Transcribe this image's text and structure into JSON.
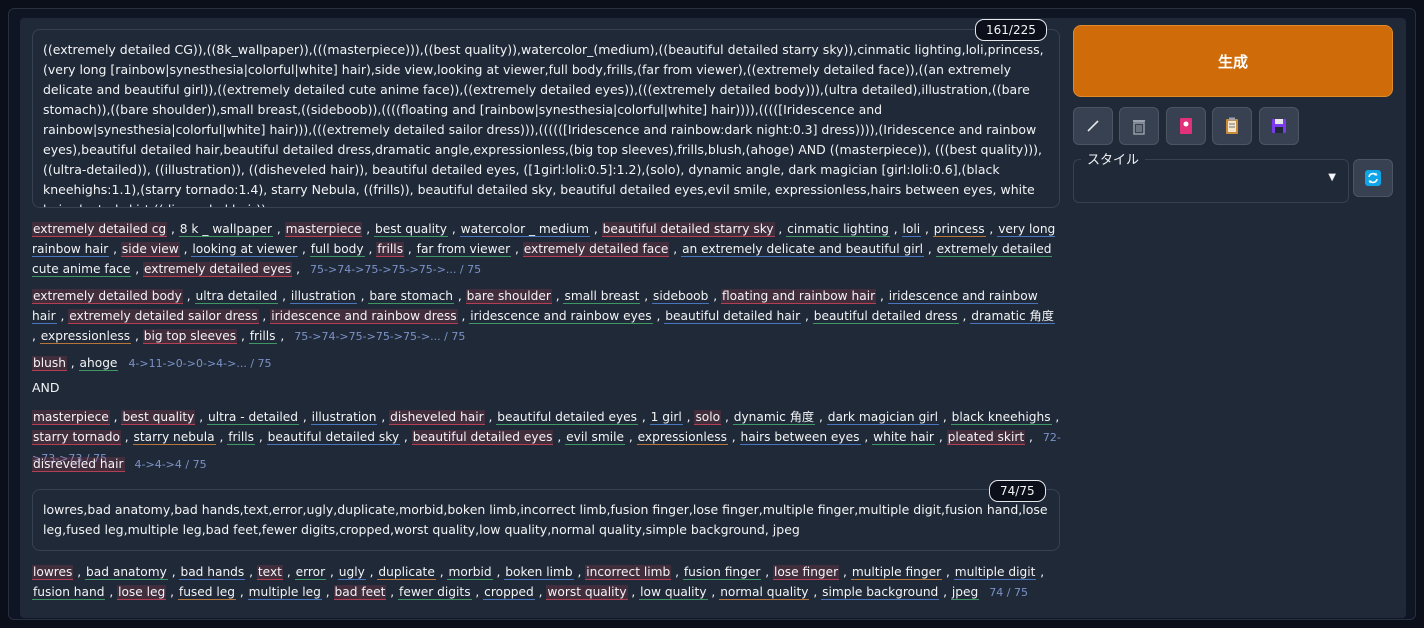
{
  "prompt": {
    "text": "((extremely detailed CG)),((8k_wallpaper)),(((masterpiece))),((best quality)),watercolor_(medium),((beautiful detailed starry sky)),cinmatic lighting,loli,princess,(very long [rainbow|synesthesia|colorful|white] hair),side view,looking at viewer,full body,frills,(far from viewer),((extremely detailed face)),((an extremely delicate and beautiful girl)),((extremely detailed cute anime face)),((extremely detailed eyes)),(((extremely detailed body))),(ultra detailed),illustration,((bare stomach)),((bare shoulder)),small breast,((sideboob)),((((floating and [rainbow|synesthesia|colorful|white] hair)))),(((([Iridescence and rainbow|synesthesia|colorful|white] hair))),(((extremely detailed sailor dress))),((((([Iridescence and rainbow:dark night:0.3] dress)))),(Iridescence and rainbow eyes),beautiful detailed hair,beautiful detailed dress,dramatic angle,expressionless,(big top sleeves),frills,blush,(ahoge) AND ((masterpiece)), (((best quality))), ((ultra-detailed)), ((illustration)), ((disheveled hair)), beautiful detailed eyes, ([1girl:loli:0.5]:1.2),(solo), dynamic angle, dark magician [girl:loli:0.6],(black kneehighs:1.1),(starry tornado:1.4), starry Nebula, ((frills)), beautiful detailed sky, beautiful detailed eyes,evil smile, expressionless,hairs between eyes,  white  hair,pleated skirt,((disreveled hair))",
    "counter": "161/225"
  },
  "token_chunks": [
    {
      "tokens": [
        [
          "extremely detailed cg",
          "r"
        ],
        [
          "8 k _ wallpaper",
          "g"
        ],
        [
          "masterpiece",
          "r"
        ],
        [
          "best quality",
          "g"
        ],
        [
          "watercolor _ medium",
          "b"
        ],
        [
          "beautiful detailed starry sky",
          "r"
        ],
        [
          "cinmatic lighting",
          "g"
        ],
        [
          "loli",
          "b"
        ],
        [
          "princess",
          "o"
        ],
        [
          "very long rainbow hair",
          "b"
        ],
        [
          "side view",
          "r"
        ],
        [
          "looking at viewer",
          "b"
        ],
        [
          "full body",
          "g"
        ],
        [
          "frills",
          "r"
        ],
        [
          "far from viewer",
          "g"
        ],
        [
          "extremely detailed face",
          "r"
        ],
        [
          "an extremely delicate and beautiful girl",
          "b"
        ],
        [
          "extremely detailed cute anime face",
          "g"
        ],
        [
          "extremely detailed eyes",
          "r"
        ]
      ],
      "count": "75->74->75->75->75->... / 75"
    },
    {
      "tokens": [
        [
          "extremely detailed body",
          "r"
        ],
        [
          "ultra detailed",
          "g"
        ],
        [
          "illustration",
          "b"
        ],
        [
          "bare stomach",
          "g"
        ],
        [
          "bare shoulder",
          "r"
        ],
        [
          "small breast",
          "g"
        ],
        [
          "sideboob",
          "b"
        ],
        [
          "floating and rainbow hair",
          "r"
        ],
        [
          "iridescence and rainbow hair",
          "b"
        ],
        [
          "extremely detailed sailor dress",
          "r"
        ],
        [
          "iridescence and rainbow dress",
          "r"
        ],
        [
          "iridescence and rainbow eyes",
          "g"
        ],
        [
          "beautiful detailed hair",
          "b"
        ],
        [
          "beautiful detailed dress",
          "g"
        ],
        [
          "dramatic 角度",
          "b"
        ],
        [
          "expressionless",
          "o"
        ],
        [
          "big top sleeves",
          "r"
        ],
        [
          "frills",
          "g"
        ]
      ],
      "count": "75->74->75->75->75->... / 75"
    },
    {
      "tokens": [
        [
          "blush",
          "r"
        ],
        [
          "ahoge",
          "g"
        ]
      ],
      "count": "4->11->0->0->4->... / 75"
    },
    {
      "tokens": [
        [
          "masterpiece",
          "r"
        ],
        [
          "best quality",
          "r"
        ],
        [
          "ultra - detailed",
          "g"
        ],
        [
          "illustration",
          "b"
        ],
        [
          "disheveled hair",
          "r"
        ],
        [
          "beautiful detailed eyes",
          "g"
        ],
        [
          "1 girl",
          "b"
        ],
        [
          "solo",
          "r"
        ],
        [
          "dynamic 角度",
          "g"
        ],
        [
          "dark magician girl",
          "b"
        ],
        [
          "black kneehighs",
          "g"
        ],
        [
          "starry tornado",
          "r"
        ],
        [
          "starry nebula",
          "o"
        ],
        [
          "frills",
          "g"
        ],
        [
          "beautiful detailed sky",
          "b"
        ],
        [
          "beautiful detailed eyes",
          "r"
        ],
        [
          "evil smile",
          "g"
        ],
        [
          "expressionless",
          "o"
        ],
        [
          "hairs between eyes",
          "b"
        ],
        [
          "white hair",
          "g"
        ],
        [
          "pleated skirt",
          "r"
        ]
      ],
      "count": "72->73->73 / 75"
    },
    {
      "tokens": [
        [
          "disreveled hair",
          "r"
        ]
      ],
      "count": "4->4->4 / 75"
    }
  ],
  "and_label": "AND",
  "negative": {
    "text": "lowres,bad anatomy,bad hands,text,error,ugly,duplicate,morbid,boken limb,incorrect limb,fusion finger,lose finger,multiple finger,multiple digit,fusion hand,lose leg,fused leg,multiple leg,bad feet,fewer digits,cropped,worst quality,low quality,normal quality,simple background, jpeg",
    "counter": "74/75",
    "tokens": [
      [
        "lowres",
        "r"
      ],
      [
        "bad anatomy",
        "g"
      ],
      [
        "bad hands",
        "b"
      ],
      [
        "text",
        "r"
      ],
      [
        "error",
        "g"
      ],
      [
        "ugly",
        "b"
      ],
      [
        "duplicate",
        "o"
      ],
      [
        "morbid",
        "g"
      ],
      [
        "boken limb",
        "b"
      ],
      [
        "incorrect limb",
        "r"
      ],
      [
        "fusion finger",
        "g"
      ],
      [
        "lose finger",
        "r"
      ],
      [
        "multiple finger",
        "o"
      ],
      [
        "multiple digit",
        "b"
      ],
      [
        "fusion hand",
        "g"
      ],
      [
        "lose leg",
        "r"
      ],
      [
        "fused leg",
        "o"
      ],
      [
        "multiple leg",
        "b"
      ],
      [
        "bad feet",
        "r"
      ],
      [
        "fewer digits",
        "g"
      ],
      [
        "cropped",
        "b"
      ],
      [
        "worst quality",
        "r"
      ],
      [
        "low quality",
        "g"
      ],
      [
        "normal quality",
        "o"
      ],
      [
        "simple background",
        "b"
      ],
      [
        "jpeg",
        "g"
      ]
    ],
    "count": "74 / 75"
  },
  "sidebar": {
    "generate_label": "生成",
    "style_label": "スタイル",
    "style_value": "",
    "tools": [
      "pencil-icon",
      "trash-icon",
      "bookmark-icon",
      "clipboard-icon",
      "save-icon"
    ]
  },
  "colors": {
    "generate": "#d06b0a",
    "background": "#0b0f19",
    "panel": "#1f2937"
  }
}
